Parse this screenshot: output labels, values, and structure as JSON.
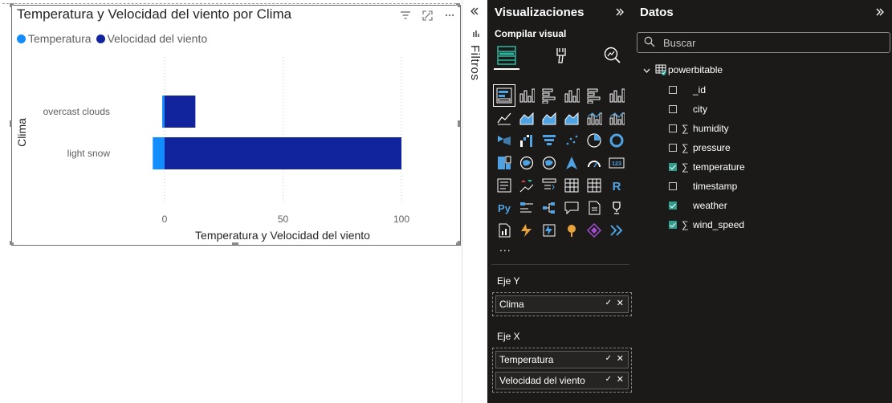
{
  "visual": {
    "title": "Temperatura y Velocidad del viento por Clima",
    "icons": [
      "filter-icon",
      "focus-mode-icon",
      "more-options-icon"
    ],
    "legend": [
      {
        "label": "Temperatura",
        "color": "#118DFF"
      },
      {
        "label": "Velocidad del viento",
        "color": "#12239E"
      }
    ]
  },
  "chart_data": {
    "type": "bar",
    "orientation": "horizontal",
    "stacked": true,
    "categories": [
      "overcast clouds",
      "light snow"
    ],
    "series": [
      {
        "name": "Temperatura",
        "values": [
          -1,
          -5
        ],
        "color": "#118DFF"
      },
      {
        "name": "Velocidad del viento",
        "values": [
          13,
          100
        ],
        "color": "#12239E"
      }
    ],
    "xlabel": "Temperatura y Velocidad del viento",
    "ylabel": "Clima",
    "xlim": [
      -5,
      118
    ],
    "x_ticks": [
      "0",
      "50",
      "100"
    ],
    "grid": "vertical dotted"
  },
  "filters_pane": {
    "label": "Filtros"
  },
  "visualizations_pane": {
    "title": "Visualizaciones",
    "build_label": "Compilar visual",
    "more_label": "...",
    "wells": [
      {
        "label": "Eje Y",
        "fields": [
          "Clima"
        ]
      },
      {
        "label": "Eje X",
        "fields": [
          "Temperatura",
          "Velocidad del viento"
        ]
      }
    ]
  },
  "data_pane": {
    "title": "Datos",
    "search_placeholder": "Buscar",
    "table_name": "powerbitable",
    "fields": [
      {
        "name": "_id",
        "checked": false,
        "sigma": false
      },
      {
        "name": "city",
        "checked": false,
        "sigma": false
      },
      {
        "name": "humidity",
        "checked": false,
        "sigma": true
      },
      {
        "name": "pressure",
        "checked": false,
        "sigma": true
      },
      {
        "name": "temperature",
        "checked": true,
        "sigma": true
      },
      {
        "name": "timestamp",
        "checked": false,
        "sigma": false
      },
      {
        "name": "weather",
        "checked": true,
        "sigma": false
      },
      {
        "name": "wind_speed",
        "checked": true,
        "sigma": true
      }
    ]
  }
}
